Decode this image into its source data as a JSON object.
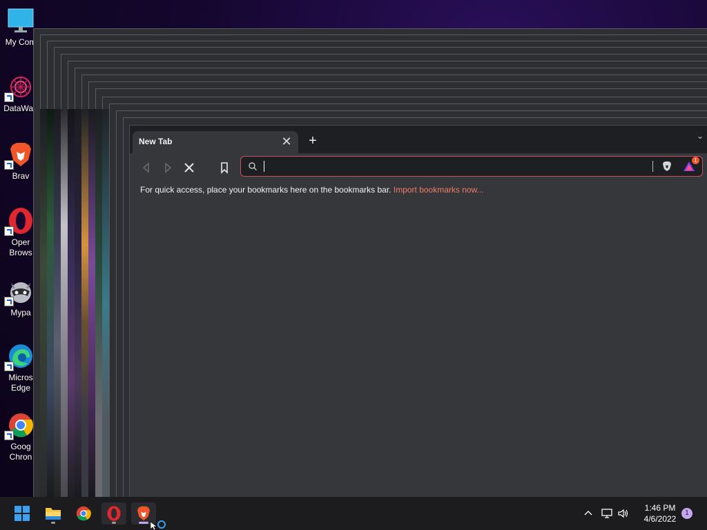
{
  "desktop": {
    "icons": [
      {
        "name": "My Computer",
        "label": "My Com"
      },
      {
        "name": "DataWag",
        "label": "DataWag"
      },
      {
        "name": "Brave",
        "label": "Brav"
      },
      {
        "name": "Opera Browser",
        "label": "Oper Brows"
      },
      {
        "name": "Mypa",
        "label": "Mypa"
      },
      {
        "name": "Microsoft Edge",
        "label": "Micros Edge"
      },
      {
        "name": "Google Chrome",
        "label": "Goog Chron"
      }
    ]
  },
  "browser": {
    "tab": {
      "title": "New Tab",
      "close_glyph": "✕"
    },
    "new_tab_glyph": "+",
    "tabs_menu_glyph": "⌄",
    "omnibox": {
      "value": "",
      "placeholder": ""
    },
    "bookmarks_bar": {
      "message": "For quick access, place your bookmarks here on the bookmarks bar.",
      "link": "Import bookmarks now..."
    },
    "rewards_badge": "1"
  },
  "taskbar": {
    "clock": {
      "time": "1:46 PM",
      "date": "4/6/2022"
    },
    "notification_count": "1",
    "tray_chevron": "^"
  },
  "colors": {
    "accent_link": "#f07b6a",
    "omnibox_border": "#c9545f",
    "brave_orange": "#f1562b",
    "opera_red": "#e0262f"
  }
}
